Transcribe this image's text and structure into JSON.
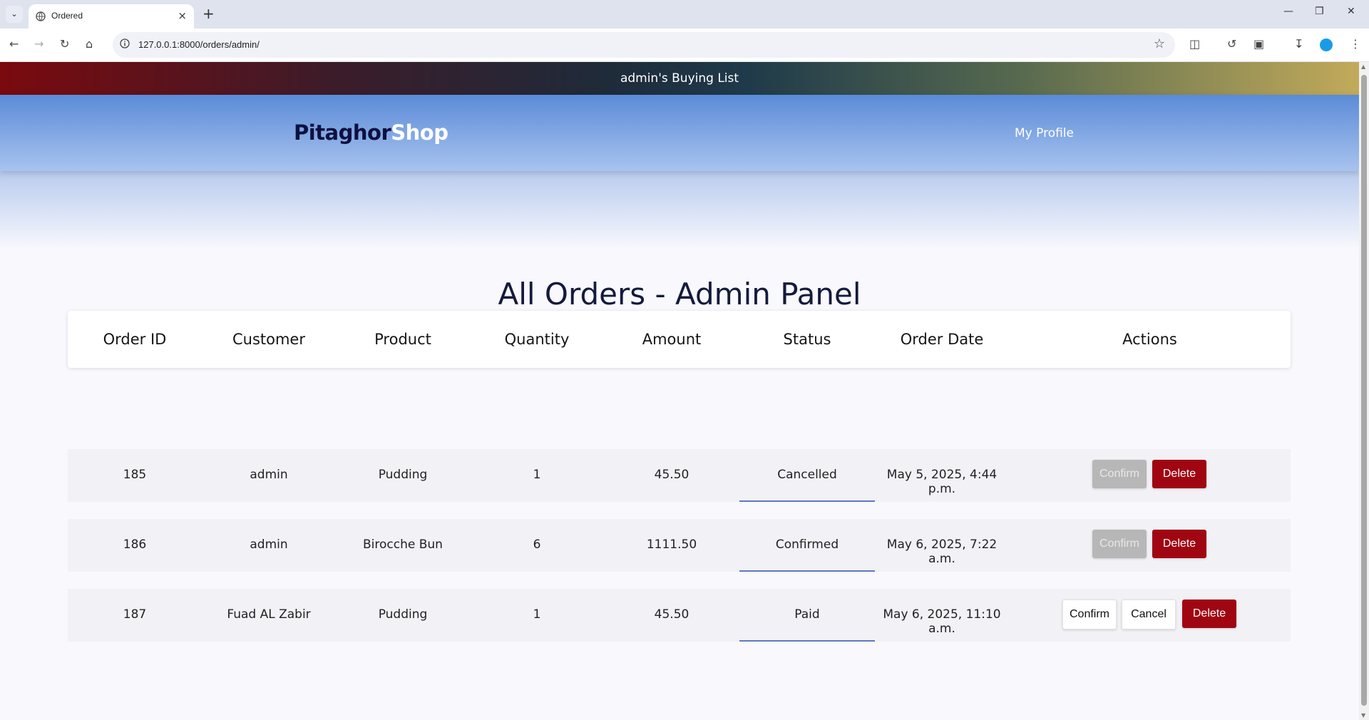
{
  "browser": {
    "tab_title": "Ordered",
    "url": "127.0.0.1:8000/orders/admin/"
  },
  "page": {
    "banner_text": "admin's Buying List",
    "logo_part1": "Pitaghor",
    "logo_part2": "Shop",
    "profile_link": "My Profile",
    "title": "All Orders - Admin Panel"
  },
  "table": {
    "headers": [
      "Order ID",
      "Customer",
      "Product",
      "Quantity",
      "Amount",
      "Status",
      "Order Date",
      "Actions"
    ],
    "rows": [
      {
        "id": "185",
        "customer": "admin",
        "product": "Pudding",
        "quantity": "1",
        "amount": "45.50",
        "status": "Cancelled",
        "date": "May 5, 2025, 4:44 p.m.",
        "actions": {
          "confirm": "Confirm",
          "delete": "Delete"
        }
      },
      {
        "id": "186",
        "customer": "admin",
        "product": "Birocche Bun",
        "quantity": "6",
        "amount": "1111.50",
        "status": "Confirmed",
        "date": "May 6, 2025, 7:22 a.m.",
        "actions": {
          "confirm": "Confirm",
          "delete": "Delete"
        }
      },
      {
        "id": "187",
        "customer": "Fuad AL Zabir",
        "product": "Pudding",
        "quantity": "1",
        "amount": "45.50",
        "status": "Paid",
        "date": "May 6, 2025, 11:10 a.m.",
        "actions": {
          "confirm": "Confirm",
          "cancel": "Cancel",
          "delete": "Delete"
        }
      }
    ]
  },
  "colors": {
    "delete_button": "#a00612",
    "disabled_button": "#b7b7b7",
    "navbar_top": "#5b8bd8",
    "logo_dark": "#0d1140"
  }
}
